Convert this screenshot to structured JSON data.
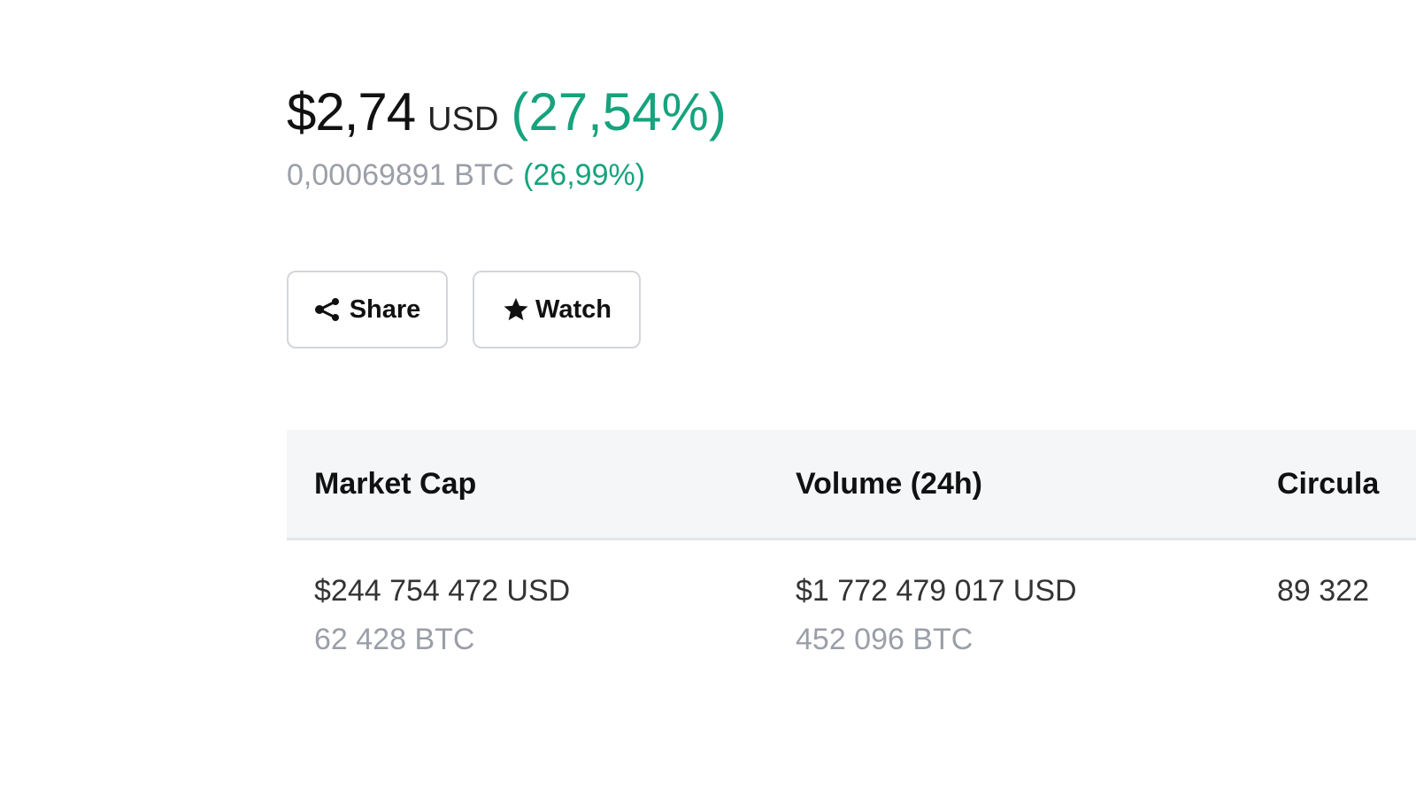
{
  "price": {
    "usd_value": "$2,74",
    "usd_unit": "USD",
    "usd_change": "(27,54%)",
    "btc_value": "0,00069891 BTC",
    "btc_change": "(26,99%)",
    "positive_color": "#16a37d"
  },
  "actions": {
    "share": {
      "label": "Share",
      "icon": "share-icon"
    },
    "watch": {
      "label": "Watch",
      "icon": "star-icon"
    }
  },
  "stats": {
    "columns": [
      {
        "header": "Market Cap",
        "usd": "$244 754 472 USD",
        "btc": "62 428 BTC"
      },
      {
        "header": "Volume (24h)",
        "usd": "$1 772 479 017 USD",
        "btc": "452 096 BTC"
      },
      {
        "header": "Circula",
        "usd": "89 322",
        "btc": ""
      }
    ]
  }
}
